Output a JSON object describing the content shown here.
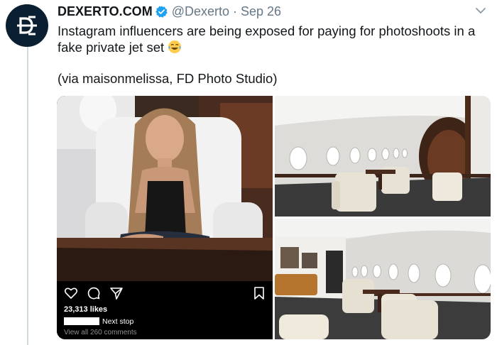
{
  "tweet": {
    "display_name": "DEXERTO.COM",
    "handle": "@Dexerto",
    "separator": "·",
    "date": "Sep 26",
    "text": "Instagram influencers are being exposed for paying for photoshoots in a fake private jet set",
    "via": "(via maisonmelissa, FD Photo Studio)"
  },
  "icons": {
    "avatar": "dexerto-logo",
    "verified": "verified-badge-icon",
    "menu": "chevron-down-icon",
    "emoji": "tears-of-joy-emoji",
    "ig_actions": [
      "heart-icon",
      "comment-icon",
      "share-icon"
    ],
    "ig_save": "bookmark-icon"
  },
  "instagram": {
    "likes": "23,313 likes",
    "caption": "Next stop",
    "comments": "View all 260 comments"
  },
  "colors": {
    "verified_blue": "#1da1f2",
    "secondary_text": "#657786",
    "avatar_bg": "#0b1f33"
  }
}
